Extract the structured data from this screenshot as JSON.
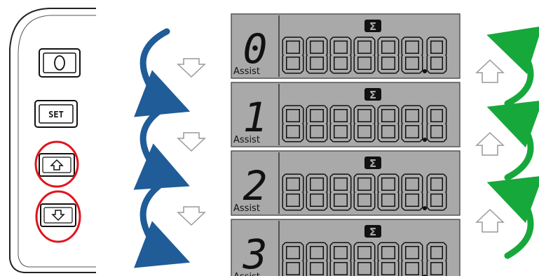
{
  "controller": {
    "buttons": [
      {
        "id": "power",
        "icon": "power-icon",
        "label": "",
        "highlighted": false
      },
      {
        "id": "set",
        "icon": "",
        "label": "SET",
        "highlighted": false
      },
      {
        "id": "up",
        "icon": "up-arrow-icon",
        "label": "",
        "highlighted": true
      },
      {
        "id": "down",
        "icon": "down-arrow-icon",
        "label": "",
        "highlighted": true
      }
    ],
    "highlight_color": "#e0131c"
  },
  "displays": [
    {
      "level": "0",
      "assist_label": "Assist",
      "segments": "888888",
      "decimal": "8",
      "sigma_icon": "sigma-icon"
    },
    {
      "level": "1",
      "assist_label": "Assist",
      "segments": "888888",
      "decimal": "8",
      "sigma_icon": "sigma-icon"
    },
    {
      "level": "2",
      "assist_label": "Assist",
      "segments": "888888",
      "decimal": "8",
      "sigma_icon": "sigma-icon"
    },
    {
      "level": "3",
      "assist_label": "Assist",
      "segments": "888888",
      "decimal": "8",
      "sigma_icon": "sigma-icon"
    }
  ],
  "flows": {
    "down_arrow_color": "#1f5c98",
    "up_arrow_color": "#17a83b",
    "lcd_background": "#a9a9a9",
    "lcd_segment_color": "#111111"
  }
}
